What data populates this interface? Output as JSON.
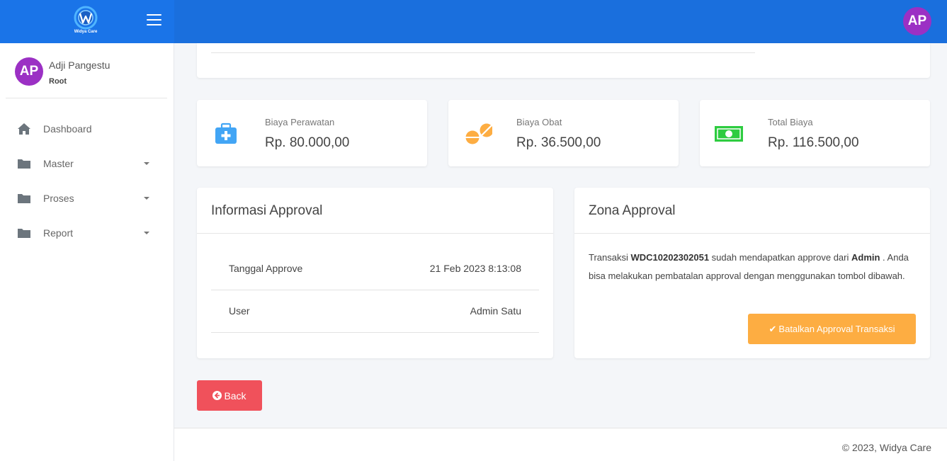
{
  "brand": {
    "name": "Widya Care",
    "avatar_initials": "AP"
  },
  "user": {
    "name": "Adji Pangestu",
    "role": "Root",
    "initials": "AP"
  },
  "sidebar": {
    "items": [
      {
        "label": "Dashboard",
        "icon": "home-icon"
      },
      {
        "label": "Master",
        "icon": "folder-icon"
      },
      {
        "label": "Proses",
        "icon": "folder-icon"
      },
      {
        "label": "Report",
        "icon": "folder-icon"
      }
    ]
  },
  "stats": [
    {
      "label": "Biaya Perawatan",
      "value": "Rp. 80.000,00",
      "icon": "medkit-icon",
      "color": "#42a5f5"
    },
    {
      "label": "Biaya Obat",
      "value": "Rp. 36.500,00",
      "icon": "pills-icon",
      "color": "#fdad42"
    },
    {
      "label": "Total Biaya",
      "value": "Rp. 116.500,00",
      "icon": "money-bill-icon",
      "color": "#2ecc40"
    }
  ],
  "info_panel": {
    "title": "Informasi Approval",
    "rows": [
      {
        "label": "Tanggal Approve",
        "value": "21 Feb 2023 8:13:08"
      },
      {
        "label": "User",
        "value": "Admin Satu"
      }
    ]
  },
  "zone_panel": {
    "title": "Zona Approval",
    "text_prefix": "Transaksi ",
    "transaction_id": "WDC10202302051",
    "text_middle": " sudah mendapatkan approve dari ",
    "approver": "Admin",
    "text_suffix": " . Anda bisa melakukan pembatalan approval dengan menggunakan tombol dibawah.",
    "cancel_button": "Batalkan Approval Transaksi"
  },
  "back_button": "Back",
  "footer": "© 2023, Widya Care",
  "colors": {
    "topbar": "#1a6fdd",
    "accent_orange": "#fdad42",
    "danger": "#f0515b",
    "avatar": "#9b30c4"
  }
}
